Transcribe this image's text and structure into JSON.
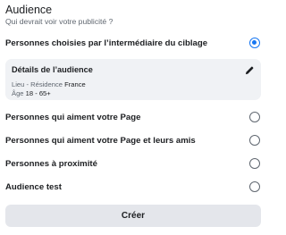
{
  "header": {
    "title": "Audience",
    "subtitle": "Qui devrait voir votre publicité ?"
  },
  "selected_option": {
    "label": "Personnes choisies par l’intermédiaire du ciblage",
    "checked": true
  },
  "details_card": {
    "title": "Détails de l’audience",
    "location_label": "Lieu - Résidence",
    "location_value": "France",
    "age_label": "Âge",
    "age_value": "18 - 65+",
    "edit_icon": "pencil-icon"
  },
  "options": [
    {
      "label": "Personnes qui aiment votre Page",
      "checked": false
    },
    {
      "label": "Personnes qui aiment votre Page et leurs amis",
      "checked": false
    },
    {
      "label": "Personnes à proximité",
      "checked": false
    },
    {
      "label": "Audience test",
      "checked": false
    }
  ],
  "footer": {
    "create_label": "Créer"
  },
  "colors": {
    "accent": "#1877f2",
    "card_bg": "#f0f2f5",
    "button_bg": "#e4e6eb",
    "text": "#1c1e21",
    "secondary_text": "#606770"
  }
}
